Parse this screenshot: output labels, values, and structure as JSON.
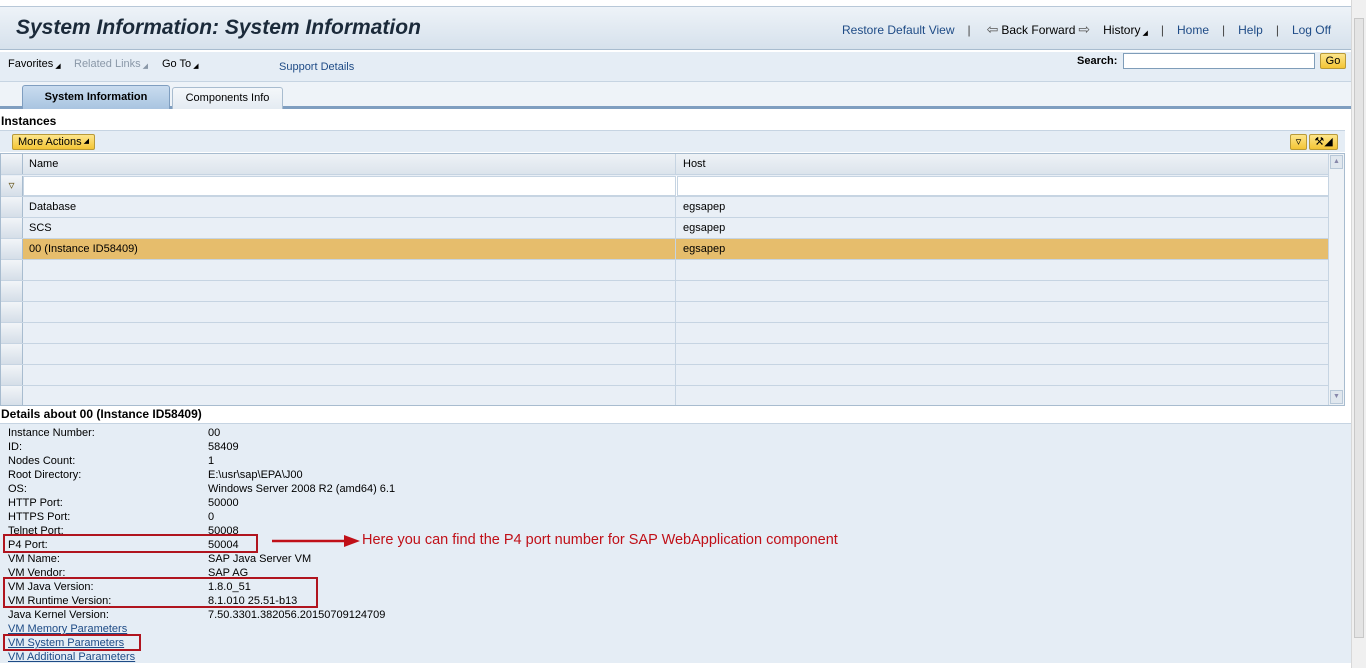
{
  "header": {
    "title": "System Information: System Information",
    "restore_default_view": "Restore Default View",
    "back_forward": "Back Forward",
    "history": "History",
    "home": "Home",
    "help": "Help",
    "log_off": "Log Off"
  },
  "toolbar": {
    "favorites": "Favorites",
    "related_links": "Related Links",
    "go_to": "Go To",
    "support_details": "Support Details",
    "search_label": "Search:",
    "search_value": "",
    "go_button": "Go"
  },
  "tabs": [
    {
      "label": "System Information",
      "active": true
    },
    {
      "label": "Components Info",
      "active": false
    }
  ],
  "instances": {
    "title": "Instances",
    "more_actions": "More Actions",
    "columns": [
      "Name",
      "Host"
    ],
    "rows": [
      {
        "name": "Database",
        "host": "egsapep",
        "selected": false
      },
      {
        "name": "SCS",
        "host": "egsapep",
        "selected": false
      },
      {
        "name": "00 (Instance ID58409)",
        "host": "egsapep",
        "selected": true
      }
    ]
  },
  "details": {
    "title": "Details about 00 (Instance ID58409)",
    "fields": [
      {
        "label": "Instance Number:",
        "value": "00"
      },
      {
        "label": "ID:",
        "value": "58409"
      },
      {
        "label": "Nodes Count:",
        "value": "1"
      },
      {
        "label": "Root Directory:",
        "value": "E:\\usr\\sap\\EPA\\J00"
      },
      {
        "label": "OS:",
        "value": "Windows Server 2008 R2 (amd64) 6.1"
      },
      {
        "label": "HTTP Port:",
        "value": "50000"
      },
      {
        "label": "HTTPS Port:",
        "value": "0"
      },
      {
        "label": "Telnet Port:",
        "value": "50008"
      },
      {
        "label": "P4 Port:",
        "value": "50004"
      },
      {
        "label": "VM Name:",
        "value": "SAP Java Server VM"
      },
      {
        "label": "VM Vendor:",
        "value": "SAP AG"
      },
      {
        "label": "VM Java Version:",
        "value": "1.8.0_51"
      },
      {
        "label": "VM Runtime Version:",
        "value": "8.1.010 25.51-b13"
      },
      {
        "label": "Java Kernel Version:",
        "value": "7.50.3301.382056.20150709124709"
      }
    ],
    "links": [
      "VM Memory Parameters",
      "VM System Parameters",
      "VM Additional Parameters"
    ]
  },
  "annotation": {
    "text": "Here you can find the P4 port number for SAP WebApplication component",
    "color": "#c01018"
  },
  "colors": {
    "accent": "#1e4b86",
    "selected_row": "#e6bd6c",
    "button_gold": "#f4c534"
  }
}
